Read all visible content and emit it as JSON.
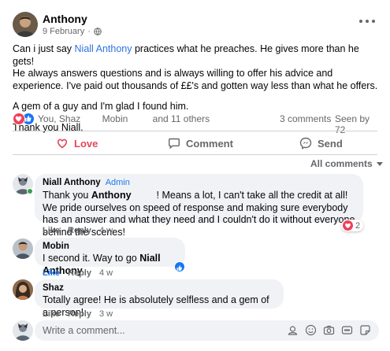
{
  "post": {
    "author": "Anthony",
    "date": "9 February",
    "separator": "·",
    "body": {
      "line1_prefix": "Can i just say ",
      "line1_link": "Niall Anthony",
      "line1_suffix": " practices what he preaches. He gives more than he gets!",
      "line2": "He always answers questions and is always willing to offer his advice and experience. I've paid out thousands of ££'s and gotten way less than  what he offers.",
      "line3": "A gem of a guy and I'm glad I found him.",
      "line4": "Thank you Niall."
    }
  },
  "reactions": {
    "names_part1": "You, Shaz",
    "names_part2": "Mobin",
    "names_part3": "and 11 others",
    "comments": "3 comments",
    "seen": "Seen by 72"
  },
  "actions": {
    "love": "Love",
    "comment": "Comment",
    "send": "Send"
  },
  "filter": {
    "label": "All comments"
  },
  "comments": [
    {
      "author": "Niall Anthony",
      "badge": "Admin",
      "text_prefix": "Thank you ",
      "text_bold": "Anthony",
      "text_suffix": "! Means a lot, I can't take all the credit at all! We pride ourselves on speed of response and making sure everybody has an answer and what they need and I couldn't do it without everyone behind the scenes!",
      "like": "Like",
      "reply": "Reply",
      "time": "4 w",
      "reaction_count": "2"
    },
    {
      "author": "Mobin",
      "text_prefix": "I second it. Way to go ",
      "text_bold": "Niall Anthony",
      "like": "Like",
      "reply": "Reply",
      "time": "4 w"
    },
    {
      "author": "Shaz",
      "text": "Totally agree! He is absolutely selfless and a gem of a person!",
      "like": "Like",
      "reply": "Reply",
      "time": "3 w"
    }
  ],
  "composer": {
    "placeholder": "Write a comment..."
  },
  "colors": {
    "link": "#2d73e0",
    "love": "#e4455a",
    "like_blue": "#1877f2",
    "heart": "#f33e58",
    "bubble": "#f0f2f5",
    "muted": "#65676b"
  },
  "icons": {
    "globe": "globe-icon",
    "more": "more-options-icon",
    "love": "heart-outline-icon",
    "comment": "speech-bubble-icon",
    "send": "messenger-icon",
    "sticker": "sticker-icon",
    "emoji": "smiley-icon",
    "camera": "camera-icon",
    "gif": "gif-icon",
    "avatar_sticker": "avatar-sticker-icon"
  }
}
